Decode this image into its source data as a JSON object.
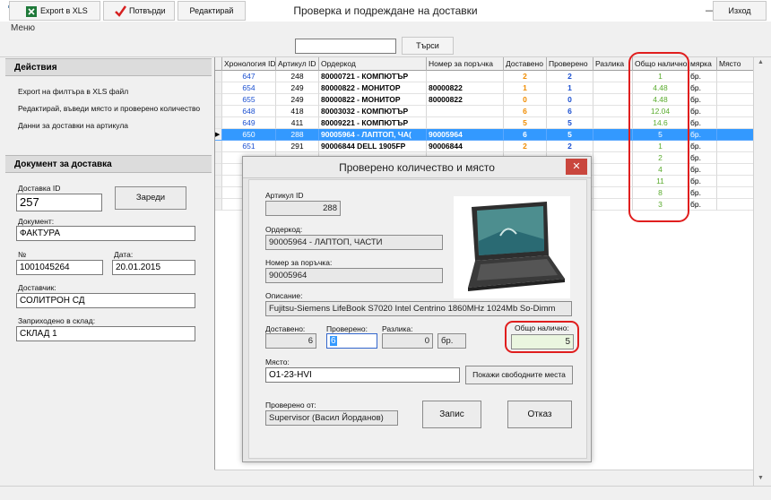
{
  "window": {
    "title": "Проверка и подреждане на доставки"
  },
  "menu": {
    "label": "Меню"
  },
  "toolbar": {
    "export": "Export в XLS",
    "confirm": "Потвърди",
    "edit": "Редактирай",
    "search": "Търси",
    "exit": "Изход",
    "search_value": ""
  },
  "actions": {
    "header": "Действия",
    "items": [
      "Export на филтъра в XLS файл",
      "Редактирай, въведи място и проверено количество",
      "Данни за доставки на артикула"
    ]
  },
  "document": {
    "header": "Документ за доставка",
    "delivery_id_label": "Доставка ID",
    "delivery_id": "257",
    "load_button": "Зареди",
    "doc_label": "Документ:",
    "doc_value": "ФАКТУРА",
    "num_label": "№",
    "num_value": "1001045264",
    "date_label": "Дата:",
    "date_value": "20.01.2015",
    "supplier_label": "Доставчик:",
    "supplier_value": "СОЛИТРОН СД",
    "warehouse_label": "Заприходено в склад:",
    "warehouse_value": "СКЛАД 1"
  },
  "grid": {
    "columns": [
      "Хронология ID",
      "Артикул ID",
      "Ордеркод",
      "Номер за поръчка",
      "Доставено",
      "Проверено",
      "Разлика",
      "Общо налично",
      "мярка",
      "Място"
    ],
    "rows": [
      {
        "chron": "647",
        "art": "248",
        "order": "80000721 - КОМПЮТЪР",
        "po": "",
        "del": "2",
        "chk": "2",
        "avail": "1",
        "unit": "бр."
      },
      {
        "chron": "654",
        "art": "249",
        "order": "80000822 - МОНИТОР",
        "po": "80000822",
        "del": "1",
        "chk": "1",
        "avail": "4.48",
        "unit": "бр."
      },
      {
        "chron": "655",
        "art": "249",
        "order": "80000822 - МОНИТОР",
        "po": "80000822",
        "del": "0",
        "chk": "0",
        "avail": "4.48",
        "unit": "бр."
      },
      {
        "chron": "648",
        "art": "418",
        "order": "80003032 - КОМПЮТЪР",
        "po": "",
        "del": "6",
        "chk": "6",
        "avail": "12.04",
        "unit": "бр."
      },
      {
        "chron": "649",
        "art": "411",
        "order": "80009221 - КОМПЮТЪР",
        "po": "",
        "del": "5",
        "chk": "5",
        "avail": "14.6",
        "unit": "бр."
      },
      {
        "chron": "650",
        "art": "288",
        "order": "90005964 - ЛАПТОП, ЧА(",
        "po": "90005964",
        "del": "6",
        "chk": "5",
        "avail": "5",
        "unit": "бр."
      },
      {
        "chron": "651",
        "art": "291",
        "order": "90006844 DELL 1905FP",
        "po": "90006844",
        "del": "2",
        "chk": "2",
        "avail": "1",
        "unit": "бр."
      }
    ],
    "extra_avail": [
      "2",
      "4",
      "11",
      "8",
      "3"
    ],
    "extra_unit": [
      "бр.",
      "бр.",
      "бр.",
      "бр.",
      "бр."
    ]
  },
  "dialog": {
    "title": "Проверено количество и място",
    "article_id_label": "Артикул ID",
    "article_id": "288",
    "ordercode_label": "Ордеркод:",
    "ordercode": "90005964 - ЛАПТОП, ЧАСТИ",
    "po_label": "Номер за поръчка:",
    "po": "90005964",
    "desc_label": "Описание:",
    "desc": "Fujitsu-Siemens LifeBook S7020 Intel Centrino 1860MHz 1024Mb So-Dimm",
    "delivered_label": "Доставено:",
    "delivered": "6",
    "checked_label": "Проверено:",
    "checked": "6",
    "diff_label": "Разлика:",
    "diff": "0",
    "unit": "бр.",
    "total_label": "Общо налично:",
    "total": "5",
    "place_label": "Място:",
    "place": "O1-23-HVI",
    "show_places": "Покажи свободните места",
    "checked_by_label": "Проверено от:",
    "checked_by": "Supervisor (Васил Йорданов)",
    "save": "Запис",
    "cancel": "Отказ"
  },
  "colors": {
    "selection": "#3399ff",
    "orange": "#f08c00",
    "blue": "#1a4fd0",
    "green": "#5aab2e",
    "highlight": "#e01e1e"
  }
}
